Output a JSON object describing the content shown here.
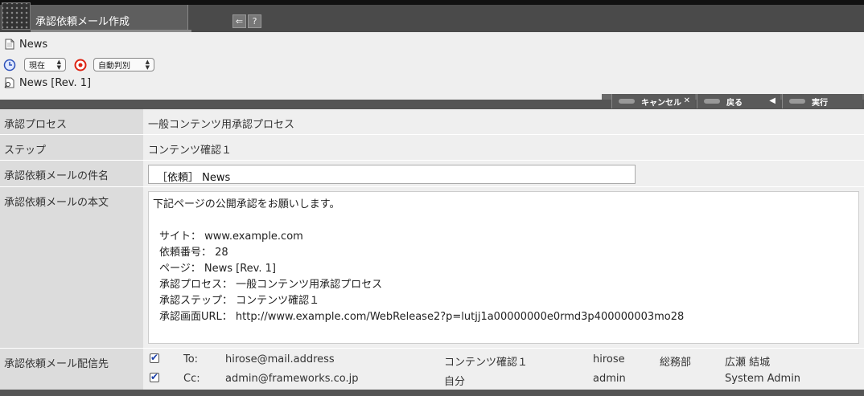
{
  "window": {
    "title": "承認依頼メール作成"
  },
  "titlebar_buttons": [
    {
      "icon": "exit-icon",
      "glyph": "⇐"
    },
    {
      "icon": "help-icon",
      "glyph": "?"
    }
  ],
  "info": {
    "page_name": "News",
    "time_select": "現在",
    "mode_select": "自動判別",
    "revision": "News [Rev. 1]"
  },
  "actions": {
    "cancel": "キャンセル",
    "back": "戻る",
    "execute": "実行"
  },
  "form": {
    "process_label": "承認プロセス",
    "process_value": "一般コンテンツ用承認プロセス",
    "step_label": "ステップ",
    "step_value": "コンテンツ確認１",
    "subject_label": "承認依頼メールの件名",
    "subject_value": "［依頼］ News",
    "body_label": "承認依頼メールの本文",
    "body_lines": [
      "下記ページの公開承認をお願いします。",
      "",
      "サイト： www.example.com",
      "依頼番号： 28",
      "ページ： News [Rev. 1]",
      "承認プロセス： 一般コンテンツ用承認プロセス",
      "承認ステップ： コンテンツ確認１",
      "承認画面URL： http://www.example.com/WebRelease2?p=lutjj1a00000000e0rmd3p400000003mo28"
    ],
    "recipients_label": "承認依頼メール配信先",
    "recipients": [
      {
        "type": "To:",
        "email": "hirose@mail.address",
        "step": "コンテンツ確認１",
        "user": "hirose",
        "dept": "総務部",
        "name": "広瀬 結城"
      },
      {
        "type": "Cc:",
        "email": "admin@frameworks.co.jp",
        "step": "自分",
        "user": "admin",
        "dept": "",
        "name": "System Admin"
      }
    ]
  }
}
